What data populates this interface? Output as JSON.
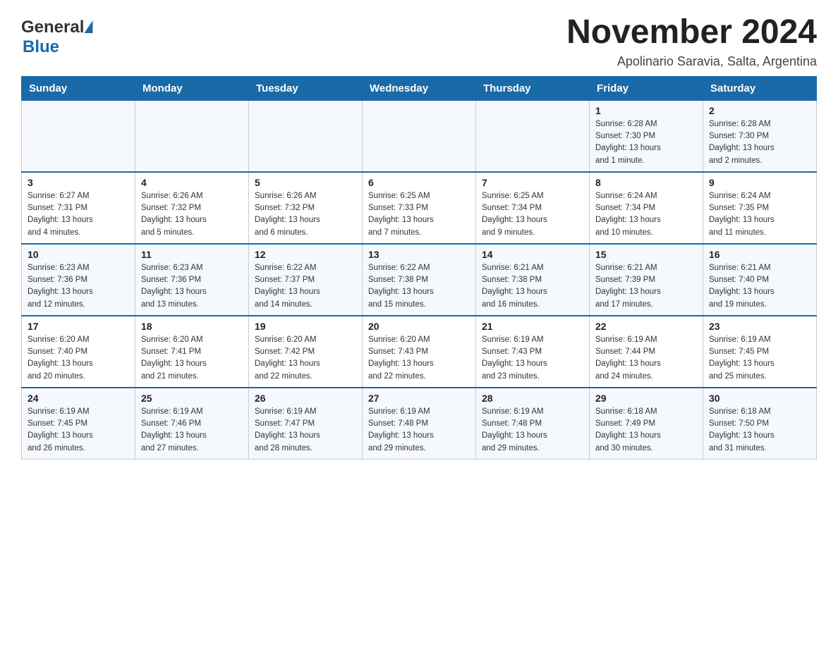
{
  "header": {
    "logo_text_general": "General",
    "logo_text_blue": "Blue",
    "month_title": "November 2024",
    "location": "Apolinario Saravia, Salta, Argentina"
  },
  "weekdays": [
    "Sunday",
    "Monday",
    "Tuesday",
    "Wednesday",
    "Thursday",
    "Friday",
    "Saturday"
  ],
  "weeks": [
    {
      "days": [
        {
          "date": "",
          "info": ""
        },
        {
          "date": "",
          "info": ""
        },
        {
          "date": "",
          "info": ""
        },
        {
          "date": "",
          "info": ""
        },
        {
          "date": "",
          "info": ""
        },
        {
          "date": "1",
          "info": "Sunrise: 6:28 AM\nSunset: 7:30 PM\nDaylight: 13 hours\nand 1 minute."
        },
        {
          "date": "2",
          "info": "Sunrise: 6:28 AM\nSunset: 7:30 PM\nDaylight: 13 hours\nand 2 minutes."
        }
      ]
    },
    {
      "days": [
        {
          "date": "3",
          "info": "Sunrise: 6:27 AM\nSunset: 7:31 PM\nDaylight: 13 hours\nand 4 minutes."
        },
        {
          "date": "4",
          "info": "Sunrise: 6:26 AM\nSunset: 7:32 PM\nDaylight: 13 hours\nand 5 minutes."
        },
        {
          "date": "5",
          "info": "Sunrise: 6:26 AM\nSunset: 7:32 PM\nDaylight: 13 hours\nand 6 minutes."
        },
        {
          "date": "6",
          "info": "Sunrise: 6:25 AM\nSunset: 7:33 PM\nDaylight: 13 hours\nand 7 minutes."
        },
        {
          "date": "7",
          "info": "Sunrise: 6:25 AM\nSunset: 7:34 PM\nDaylight: 13 hours\nand 9 minutes."
        },
        {
          "date": "8",
          "info": "Sunrise: 6:24 AM\nSunset: 7:34 PM\nDaylight: 13 hours\nand 10 minutes."
        },
        {
          "date": "9",
          "info": "Sunrise: 6:24 AM\nSunset: 7:35 PM\nDaylight: 13 hours\nand 11 minutes."
        }
      ]
    },
    {
      "days": [
        {
          "date": "10",
          "info": "Sunrise: 6:23 AM\nSunset: 7:36 PM\nDaylight: 13 hours\nand 12 minutes."
        },
        {
          "date": "11",
          "info": "Sunrise: 6:23 AM\nSunset: 7:36 PM\nDaylight: 13 hours\nand 13 minutes."
        },
        {
          "date": "12",
          "info": "Sunrise: 6:22 AM\nSunset: 7:37 PM\nDaylight: 13 hours\nand 14 minutes."
        },
        {
          "date": "13",
          "info": "Sunrise: 6:22 AM\nSunset: 7:38 PM\nDaylight: 13 hours\nand 15 minutes."
        },
        {
          "date": "14",
          "info": "Sunrise: 6:21 AM\nSunset: 7:38 PM\nDaylight: 13 hours\nand 16 minutes."
        },
        {
          "date": "15",
          "info": "Sunrise: 6:21 AM\nSunset: 7:39 PM\nDaylight: 13 hours\nand 17 minutes."
        },
        {
          "date": "16",
          "info": "Sunrise: 6:21 AM\nSunset: 7:40 PM\nDaylight: 13 hours\nand 19 minutes."
        }
      ]
    },
    {
      "days": [
        {
          "date": "17",
          "info": "Sunrise: 6:20 AM\nSunset: 7:40 PM\nDaylight: 13 hours\nand 20 minutes."
        },
        {
          "date": "18",
          "info": "Sunrise: 6:20 AM\nSunset: 7:41 PM\nDaylight: 13 hours\nand 21 minutes."
        },
        {
          "date": "19",
          "info": "Sunrise: 6:20 AM\nSunset: 7:42 PM\nDaylight: 13 hours\nand 22 minutes."
        },
        {
          "date": "20",
          "info": "Sunrise: 6:20 AM\nSunset: 7:43 PM\nDaylight: 13 hours\nand 22 minutes."
        },
        {
          "date": "21",
          "info": "Sunrise: 6:19 AM\nSunset: 7:43 PM\nDaylight: 13 hours\nand 23 minutes."
        },
        {
          "date": "22",
          "info": "Sunrise: 6:19 AM\nSunset: 7:44 PM\nDaylight: 13 hours\nand 24 minutes."
        },
        {
          "date": "23",
          "info": "Sunrise: 6:19 AM\nSunset: 7:45 PM\nDaylight: 13 hours\nand 25 minutes."
        }
      ]
    },
    {
      "days": [
        {
          "date": "24",
          "info": "Sunrise: 6:19 AM\nSunset: 7:45 PM\nDaylight: 13 hours\nand 26 minutes."
        },
        {
          "date": "25",
          "info": "Sunrise: 6:19 AM\nSunset: 7:46 PM\nDaylight: 13 hours\nand 27 minutes."
        },
        {
          "date": "26",
          "info": "Sunrise: 6:19 AM\nSunset: 7:47 PM\nDaylight: 13 hours\nand 28 minutes."
        },
        {
          "date": "27",
          "info": "Sunrise: 6:19 AM\nSunset: 7:48 PM\nDaylight: 13 hours\nand 29 minutes."
        },
        {
          "date": "28",
          "info": "Sunrise: 6:19 AM\nSunset: 7:48 PM\nDaylight: 13 hours\nand 29 minutes."
        },
        {
          "date": "29",
          "info": "Sunrise: 6:18 AM\nSunset: 7:49 PM\nDaylight: 13 hours\nand 30 minutes."
        },
        {
          "date": "30",
          "info": "Sunrise: 6:18 AM\nSunset: 7:50 PM\nDaylight: 13 hours\nand 31 minutes."
        }
      ]
    }
  ]
}
